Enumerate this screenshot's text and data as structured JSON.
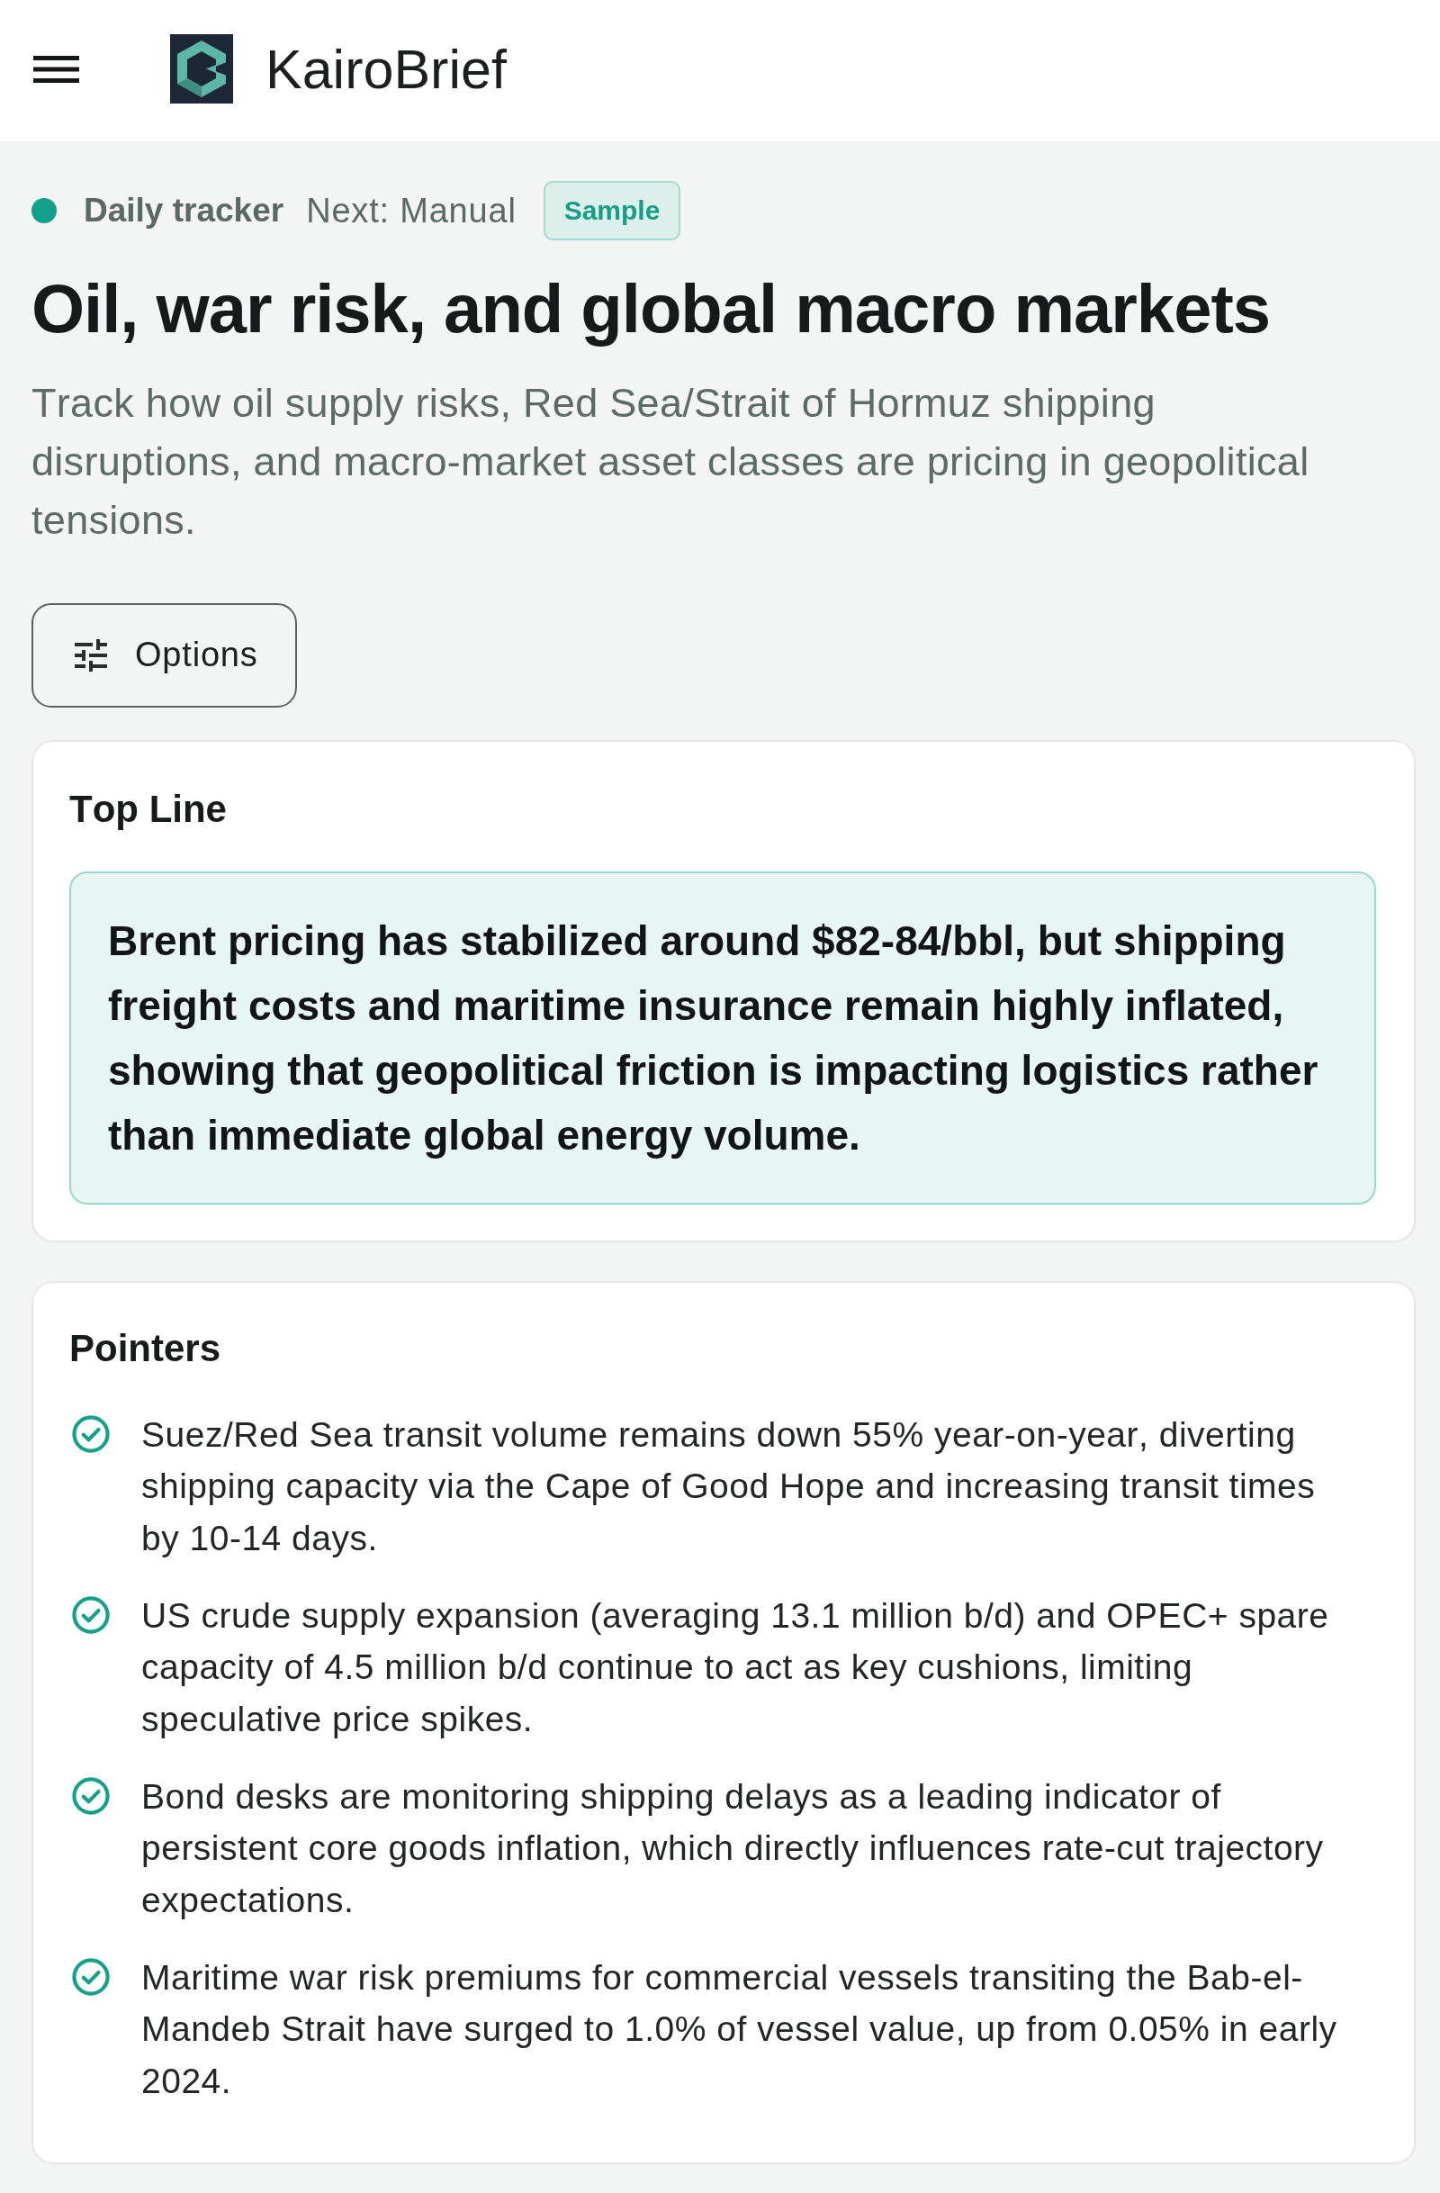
{
  "header": {
    "brand": "KairoBrief"
  },
  "status": {
    "label": "Daily tracker",
    "next": "Next: Manual",
    "badge": "Sample"
  },
  "page": {
    "title": "Oil, war risk, and global macro markets",
    "description": "Track how oil supply risks, Red Sea/Strait of Hormuz shipping disruptions, and macro-market asset classes are pricing in geopolitical tensions."
  },
  "options_button": {
    "label": "Options"
  },
  "sections": [
    {
      "kind": "callout",
      "title": "Top Line",
      "text": "Brent pricing has stabilized around $82-84/bbl, but shipping freight costs and maritime insurance remain highly inflated, showing that geopolitical friction is impacting logistics rather than immediate global energy volume."
    },
    {
      "kind": "checklist",
      "title": "Pointers",
      "items": [
        "Suez/Red Sea transit volume remains down 55% year-on-year, diverting shipping capacity via the Cape of Good Hope and increasing transit times by 10-14 days.",
        "US crude supply expansion (averaging 13.1 million b/d) and OPEC+ spare capacity of 4.5 million b/d continue to act as key cushions, limiting speculative price spikes.",
        "Bond desks are monitoring shipping delays as a leading indicator of persistent core goods inflation, which directly influences rate-cut trajectory expectations.",
        "Maritime war risk premiums for commercial vessels transiting the Bab-el-Mandeb Strait have surged to 1.0% of vessel value, up from 0.05% in early 2024."
      ]
    }
  ]
}
